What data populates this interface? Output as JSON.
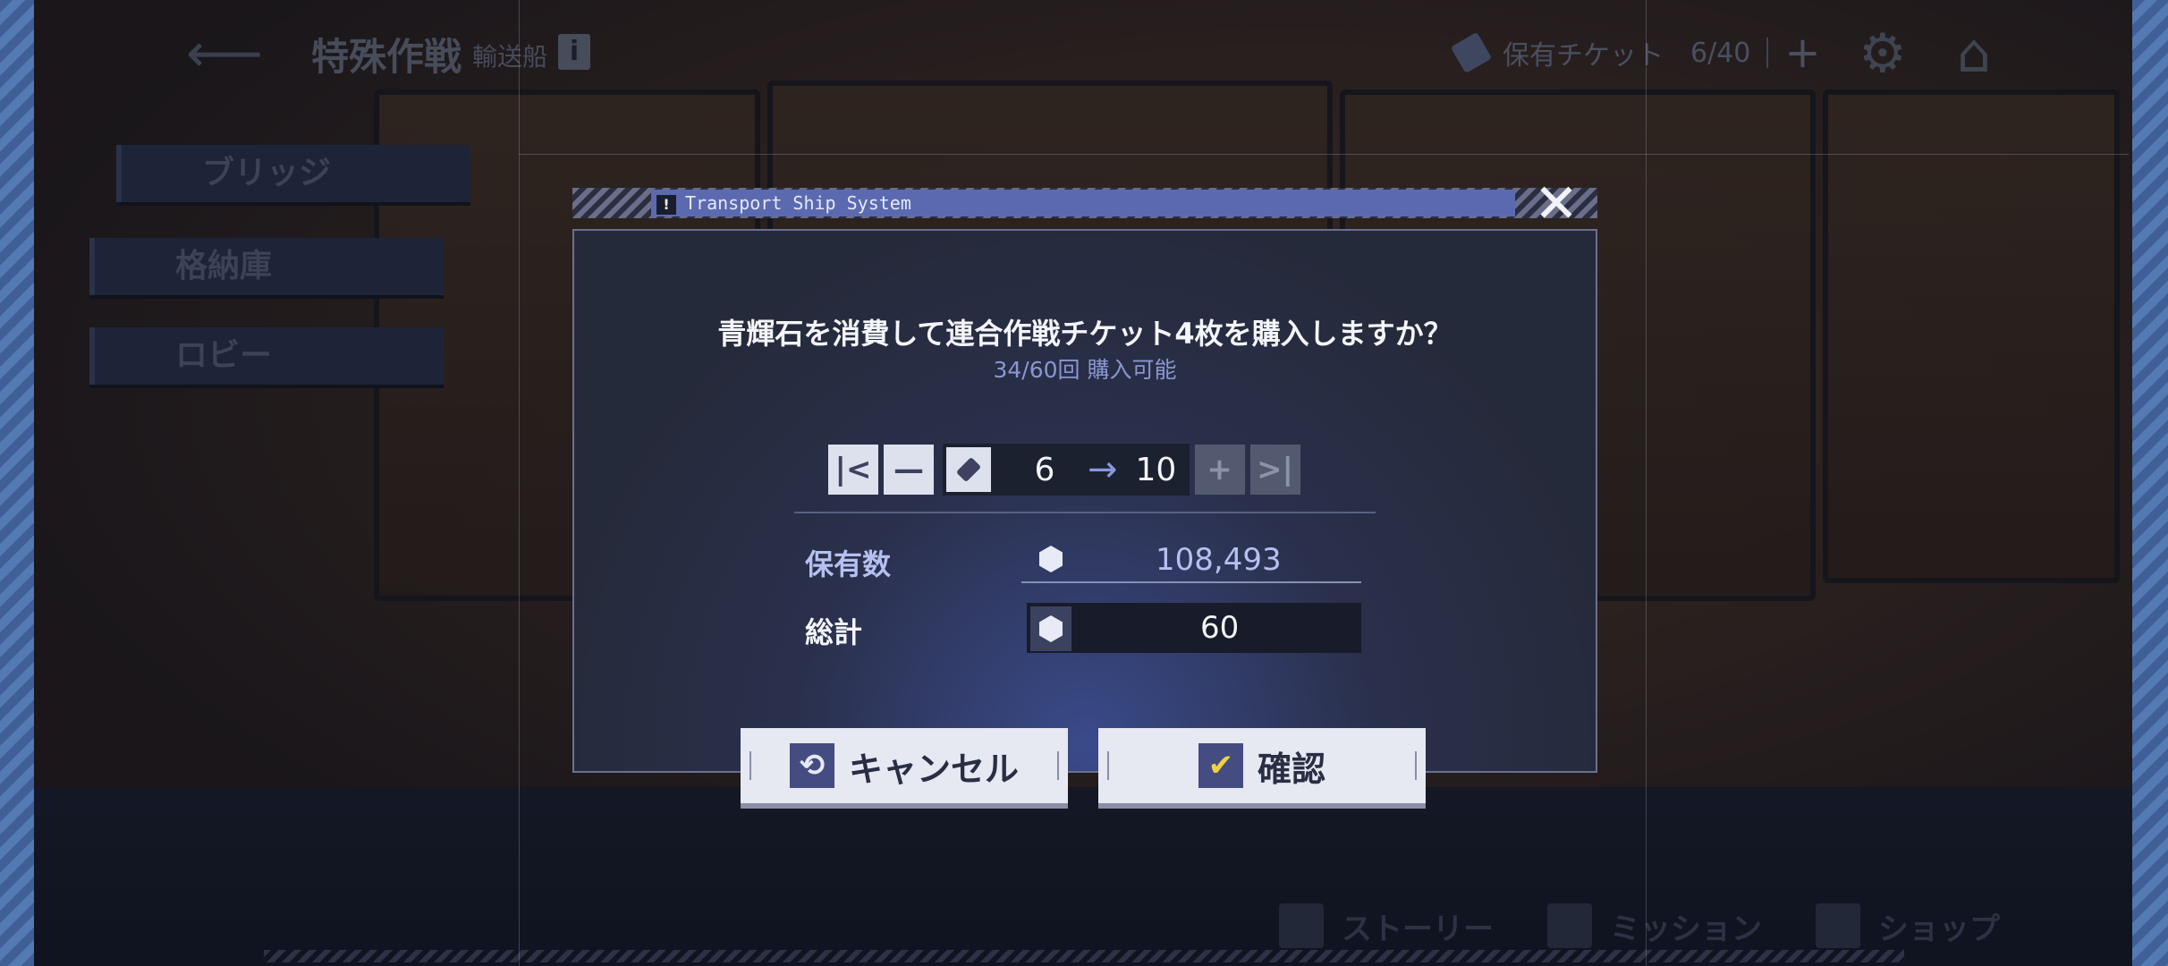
{
  "header": {
    "title": "特殊作戦",
    "subtitle": "輸送船",
    "info_icon": "i",
    "ticket_label": "保有チケット",
    "ticket_count": "6/40",
    "add_symbol": "+"
  },
  "side_nav": {
    "items": [
      {
        "label": "ブリッジ"
      },
      {
        "label": "格納庫"
      },
      {
        "label": "ロビー"
      }
    ]
  },
  "bottom_nav": {
    "items": [
      {
        "label": "ストーリー"
      },
      {
        "label": "ミッション"
      },
      {
        "label": "ショップ"
      }
    ]
  },
  "dialog": {
    "header_title": "Transport Ship System",
    "warning_glyph": "!",
    "question": "青輝石を消費して連合作戦チケット4枚を購入しますか？",
    "remaining": "34/60回 購入可能",
    "stepper": {
      "min_symbol": "|<",
      "minus_symbol": "—",
      "current": "6",
      "target": "10",
      "plus_symbol": "+",
      "max_symbol": ">|"
    },
    "owned_label": "保有数",
    "owned_value": "108,493",
    "total_label": "総計",
    "total_value": "60",
    "cancel_label": "キャンセル",
    "confirm_label": "確認"
  },
  "colors": {
    "accent": "#5b6ab0",
    "button_icon_bg": "#444c82",
    "owned_value": "#b6c0f0",
    "subtext": "#8a96d2",
    "check": "#f0d23c"
  },
  "icons": [
    "back-arrow-icon",
    "info-icon",
    "ticket-icon",
    "gear-icon",
    "home-icon",
    "close-icon",
    "gem-icon",
    "cancel-icon",
    "check-icon",
    "arrow-right-icon"
  ]
}
